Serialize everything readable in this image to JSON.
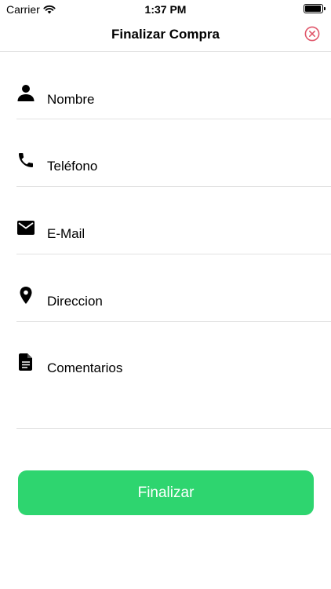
{
  "status_bar": {
    "carrier": "Carrier",
    "time": "1:37 PM",
    "battery_level": 0.95
  },
  "nav": {
    "title": "Finalizar Compra",
    "close_icon": "close-circle-icon"
  },
  "form": {
    "fields": [
      {
        "label": "Nombre",
        "icon": "person-icon"
      },
      {
        "label": "Teléfono",
        "icon": "phone-icon"
      },
      {
        "label": "E-Mail",
        "icon": "mail-icon"
      },
      {
        "label": "Direccion",
        "icon": "location-pin-icon"
      },
      {
        "label": "Comentarios",
        "icon": "document-icon"
      }
    ]
  },
  "submit": {
    "label": "Finalizar"
  },
  "colors": {
    "accent": "#2ed56f",
    "close": "#e0566a",
    "separator": "#e2e2e2"
  }
}
